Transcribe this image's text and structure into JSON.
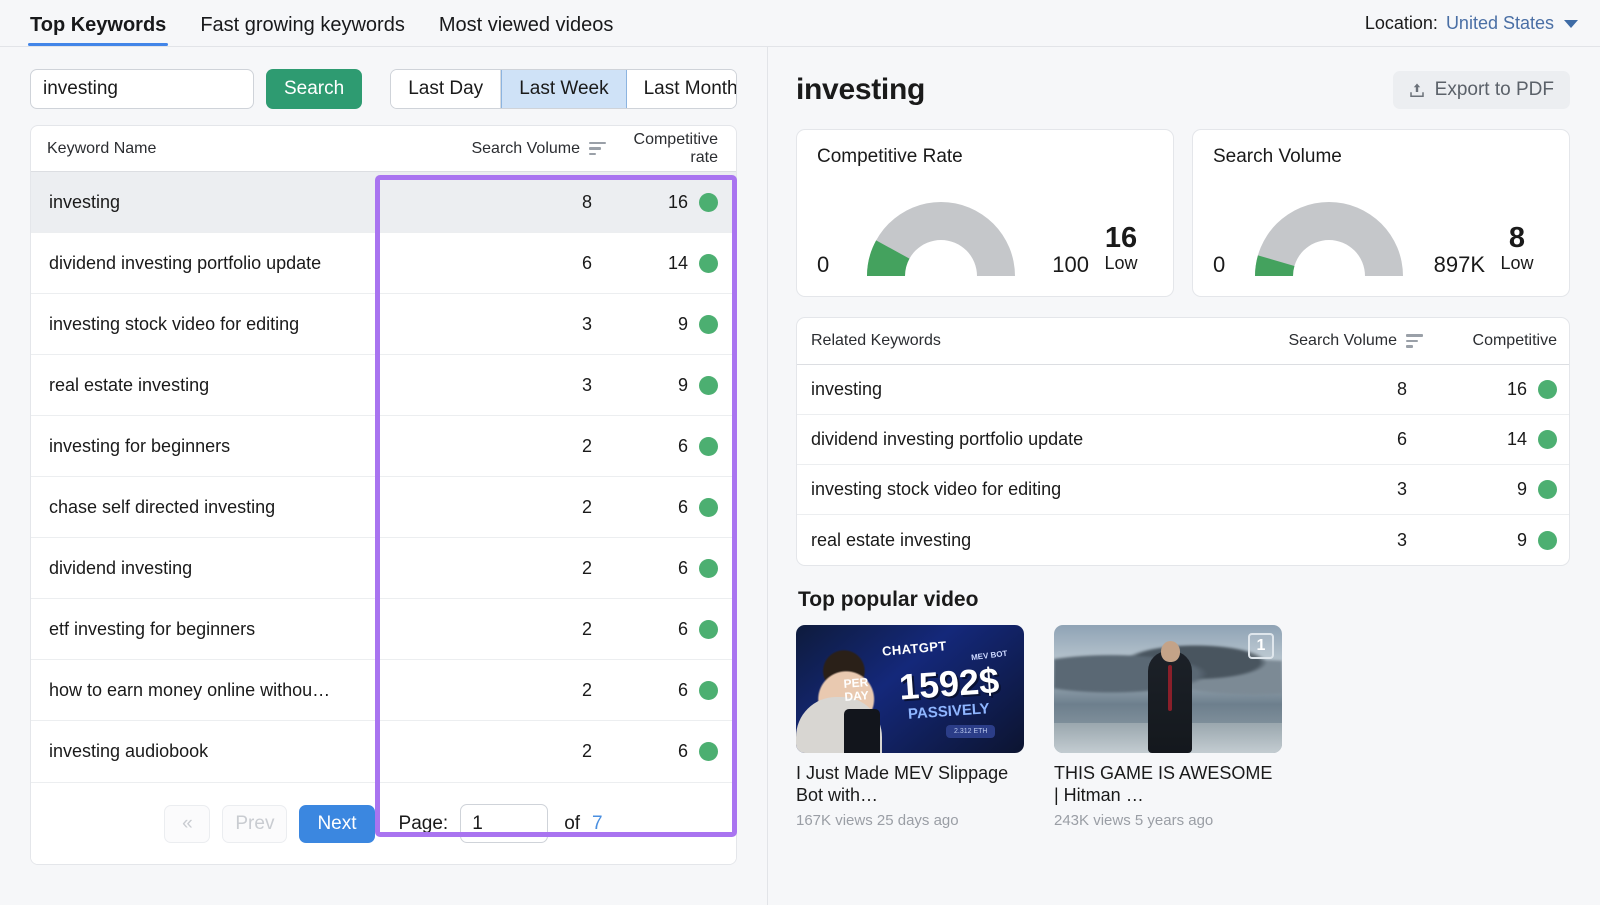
{
  "header": {
    "tabs": [
      {
        "label": "Top Keywords",
        "active": true
      },
      {
        "label": "Fast growing keywords",
        "active": false
      },
      {
        "label": "Most viewed videos",
        "active": false
      }
    ],
    "location_label": "Location:",
    "location_value": "United States",
    "chevron_icon": "chevron-down-icon"
  },
  "search": {
    "value": "investing",
    "placeholder": "",
    "button_label": "Search"
  },
  "range": {
    "options": [
      "Last Day",
      "Last Week",
      "Last Month"
    ],
    "selected": "Last Week"
  },
  "keywords_table": {
    "columns": [
      "Keyword Name",
      "Search Volume",
      "Competitive rate"
    ],
    "sort_icon": "sort-descending-icon",
    "rows": [
      {
        "name": "investing",
        "volume": "8",
        "competitive": "16",
        "selected": true
      },
      {
        "name": "dividend investing portfolio update",
        "volume": "6",
        "competitive": "14",
        "selected": false
      },
      {
        "name": "investing stock video for editing",
        "volume": "3",
        "competitive": "9",
        "selected": false
      },
      {
        "name": "real estate investing",
        "volume": "3",
        "competitive": "9",
        "selected": false
      },
      {
        "name": "investing for beginners",
        "volume": "2",
        "competitive": "6",
        "selected": false
      },
      {
        "name": "chase self directed investing",
        "volume": "2",
        "competitive": "6",
        "selected": false
      },
      {
        "name": "dividend investing",
        "volume": "2",
        "competitive": "6",
        "selected": false
      },
      {
        "name": "etf investing for beginners",
        "volume": "2",
        "competitive": "6",
        "selected": false
      },
      {
        "name": "how to earn money online withou…",
        "volume": "2",
        "competitive": "6",
        "selected": false
      },
      {
        "name": "investing audiobook",
        "volume": "2",
        "competitive": "6",
        "selected": false
      }
    ]
  },
  "pagination": {
    "first_label": "«",
    "prev_label": "Prev",
    "next_label": "Next",
    "page_label": "Page:",
    "page_value": "1",
    "of_label": "of",
    "total_pages": "7"
  },
  "detail": {
    "title": "investing",
    "export_label": "Export to PDF",
    "export_icon": "upload-icon"
  },
  "gauges": [
    {
      "title": "Competitive Rate",
      "min": "0",
      "max": "100",
      "value": "16",
      "level": "Low",
      "percent": 16
    },
    {
      "title": "Search Volume",
      "min": "0",
      "max": "897K",
      "value": "8",
      "level": "Low",
      "percent": 9
    }
  ],
  "related_table": {
    "columns": [
      "Related Keywords",
      "Search Volume",
      "Competitive"
    ],
    "sort_icon": "sort-descending-icon",
    "rows": [
      {
        "name": "investing",
        "volume": "8",
        "competitive": "16"
      },
      {
        "name": "dividend investing portfolio update",
        "volume": "6",
        "competitive": "14"
      },
      {
        "name": "investing stock video for editing",
        "volume": "3",
        "competitive": "9"
      },
      {
        "name": "real estate investing",
        "volume": "3",
        "competitive": "9"
      }
    ]
  },
  "videos": {
    "section_title": "Top popular video",
    "items": [
      {
        "title": "I Just Made MEV Slippage Bot with…",
        "meta": "167K views 25 days ago",
        "rank": "",
        "thumb_text": {
          "brand": "CHATGPT",
          "sub": "MEV BOT",
          "amount": "1592$",
          "perday": "PER\nDAY",
          "passively": "PASSIVELY",
          "eth": "2.312 ETH"
        }
      },
      {
        "title": "THIS GAME IS AWESOME | Hitman …",
        "meta": "243K views 5 years ago",
        "rank": "1",
        "thumb_text": null
      }
    ]
  },
  "colors": {
    "accent_blue": "#3b87e0",
    "search_green": "#2e9b71",
    "dot_green": "#4caf71",
    "highlight_purple": "#a974f0",
    "gauge_track": "#c5c7ca",
    "gauge_fill": "#44a25e"
  }
}
